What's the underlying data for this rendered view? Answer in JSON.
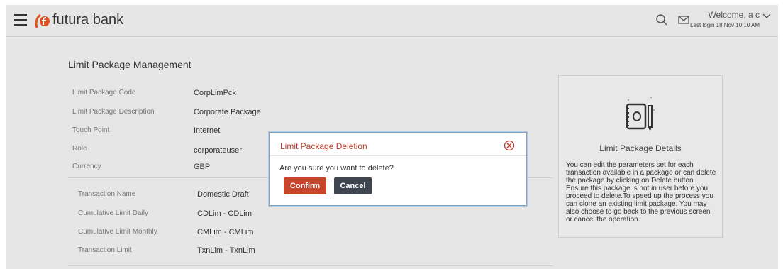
{
  "header": {
    "brand": "futura bank",
    "welcome": "Welcome, a c",
    "last_login": "Last login 18 Nov 10:10 AM"
  },
  "page": {
    "title": "Limit Package Management"
  },
  "details": [
    {
      "label": "Limit Package Code",
      "value": "CorpLimPck"
    },
    {
      "label": "Limit Package Description",
      "value": "Corporate Package"
    },
    {
      "label": "Touch Point",
      "value": "Internet"
    },
    {
      "label": "Role",
      "value": "corporateuser"
    },
    {
      "label": "Currency",
      "value": "GBP"
    }
  ],
  "transaction": [
    {
      "label": "Transaction Name",
      "value": "Domestic Draft"
    },
    {
      "label": "Cumulative Limit Daily",
      "value": "CDLim - CDLim"
    },
    {
      "label": "Cumulative Limit Monthly",
      "value": "CMLim - CMLim"
    },
    {
      "label": "Transaction Limit",
      "value": "TxnLim - TxnLim"
    }
  ],
  "side_panel": {
    "title": "Limit Package Details",
    "text": "You can edit the parameters set for each transaction available in a package or can delete the package by clicking on Delete button. Ensure this package is not in user before you proceed to delete.To speed up the process you can clone an existing limit package. You may also choose to go back to the previous screen or cancel the operation."
  },
  "modal": {
    "title": "Limit Package Deletion",
    "message": "Are you sure you want to delete?",
    "confirm_label": "Confirm",
    "cancel_label": "Cancel"
  },
  "colors": {
    "accent": "#c8452b",
    "modal_title": "#c0392b",
    "cancel": "#3f4650",
    "overlay_bg": "#e6e6e6"
  },
  "icons": [
    "menu-icon",
    "futura-logo-icon",
    "search-icon",
    "mail-icon",
    "chevron-down-icon",
    "notebook-icon",
    "close-circle-icon"
  ]
}
